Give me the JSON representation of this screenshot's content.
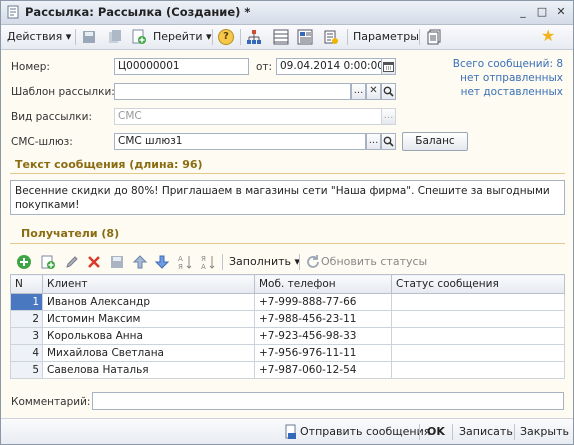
{
  "window": {
    "title": "Рассылка: Рассылка (Создание) *",
    "minimize": "_",
    "maximize": "□",
    "close": "✕"
  },
  "toolbar": {
    "actions_label": "Действия",
    "goto_label": "Перейти",
    "params_label": "Параметры",
    "dropdown_glyph": "▾",
    "help_glyph": "?",
    "star_glyph": "★"
  },
  "form": {
    "number_label": "Номер:",
    "number_value": "Ц00000001",
    "date_label": "от:",
    "date_value": "09.04.2014  0:00:00",
    "template_label": "Шаблон рассылки:",
    "template_value": "",
    "type_label": "Вид рассылки:",
    "type_value": "СМС",
    "gateway_label": "СМС-шлюз:",
    "gateway_value": "СМС шлюз1",
    "balance_button": "Баланс",
    "ellipsis": "...",
    "clear_glyph": "✕"
  },
  "stats": {
    "total": "Всего сообщений: 8",
    "not_sent": "нет отправленных",
    "not_delivered": "нет доставленных"
  },
  "message_section": {
    "title": "Текст сообщения (длина: 96)",
    "text": "Весенние скидки до 80%! Приглашаем в магазины сети \"Наша фирма\". Спешите за выгодными покупками!"
  },
  "recipients_section": {
    "title": "Получатели (8)",
    "fill_label": "Заполнить",
    "refresh_label": "Обновить статусы"
  },
  "table": {
    "headers": [
      "N",
      "Клиент",
      "Моб. телефон",
      "Статус сообщения"
    ],
    "rows": [
      {
        "n": "1",
        "client": "Иванов Александр",
        "phone": "+7-999-888-77-66",
        "status": ""
      },
      {
        "n": "2",
        "client": "Истомин Максим",
        "phone": "+7-988-456-23-11",
        "status": ""
      },
      {
        "n": "3",
        "client": "Королькова Анна",
        "phone": "+7-923-456-98-33",
        "status": ""
      },
      {
        "n": "4",
        "client": "Михайлова Светлана",
        "phone": "+7-956-976-11-11",
        "status": ""
      },
      {
        "n": "5",
        "client": "Савелова Наталья",
        "phone": "+7-987-060-12-54",
        "status": ""
      }
    ]
  },
  "comment": {
    "label": "Комментарий:",
    "value": ""
  },
  "bottom": {
    "send_label": "Отправить сообщения",
    "ok_label": "OK",
    "save_label": "Записать",
    "close_label": "Закрыть"
  }
}
